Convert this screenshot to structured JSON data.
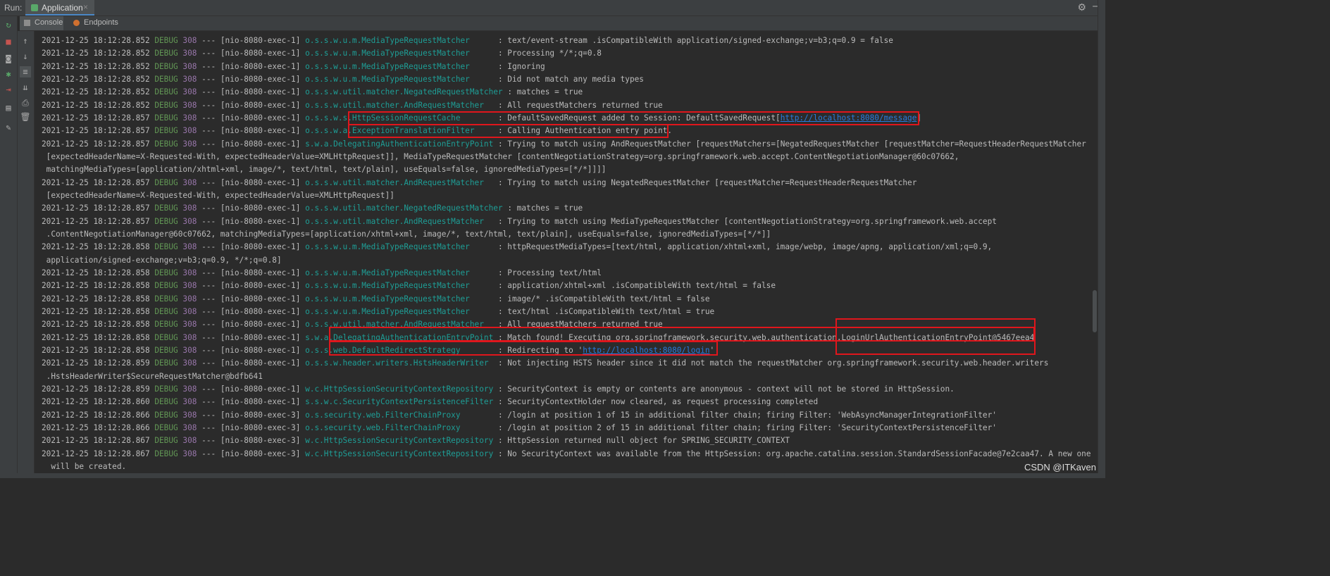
{
  "run": {
    "label": "Run:",
    "tab": "Application"
  },
  "console_tabs": [
    {
      "label": "Console"
    },
    {
      "label": "Endpoints"
    }
  ],
  "url_message": "http://localhost:8080/message",
  "url_login": "http://localhost:8080/login",
  "watermark": "CSDN @ITKaven",
  "log_lines": [
    {
      "ts": "2021-12-25 18:12:28.852",
      "level": "DEBUG",
      "pid": "308",
      "thread": "--- [nio-8080-exec-1]",
      "logger": "o.s.s.w.u.m.MediaTypeRequestMatcher",
      "msg": ": text/event-stream .isCompatibleWith application/signed-exchange;v=b3;q=0.9 = false"
    },
    {
      "ts": "2021-12-25 18:12:28.852",
      "level": "DEBUG",
      "pid": "308",
      "thread": "--- [nio-8080-exec-1]",
      "logger": "o.s.s.w.u.m.MediaTypeRequestMatcher",
      "msg": ": Processing */*;q=0.8"
    },
    {
      "ts": "2021-12-25 18:12:28.852",
      "level": "DEBUG",
      "pid": "308",
      "thread": "--- [nio-8080-exec-1]",
      "logger": "o.s.s.w.u.m.MediaTypeRequestMatcher",
      "msg": ": Ignoring"
    },
    {
      "ts": "2021-12-25 18:12:28.852",
      "level": "DEBUG",
      "pid": "308",
      "thread": "--- [nio-8080-exec-1]",
      "logger": "o.s.s.w.u.m.MediaTypeRequestMatcher",
      "msg": ": Did not match any media types"
    },
    {
      "ts": "2021-12-25 18:12:28.852",
      "level": "DEBUG",
      "pid": "308",
      "thread": "--- [nio-8080-exec-1]",
      "logger": "o.s.s.w.util.matcher.NegatedRequestMatcher",
      "msg": ": matches = true"
    },
    {
      "ts": "2021-12-25 18:12:28.852",
      "level": "DEBUG",
      "pid": "308",
      "thread": "--- [nio-8080-exec-1]",
      "logger": "o.s.s.w.util.matcher.AndRequestMatcher",
      "msg": ": All requestMatchers returned true"
    },
    {
      "ts": "2021-12-25 18:12:28.857",
      "level": "DEBUG",
      "pid": "308",
      "thread": "--- [nio-8080-exec-1]",
      "logger": "o.s.s.w.s.HttpSessionRequestCache",
      "msg": ": DefaultSavedRequest added to Session: DefaultSavedRequest["
    },
    {
      "ts": "2021-12-25 18:12:28.857",
      "level": "DEBUG",
      "pid": "308",
      "thread": "--- [nio-8080-exec-1]",
      "logger": "o.s.s.w.a.ExceptionTranslationFilter",
      "msg": ": Calling Authentication entry point."
    },
    {
      "ts": "2021-12-25 18:12:28.857",
      "level": "DEBUG",
      "pid": "308",
      "thread": "--- [nio-8080-exec-1]",
      "logger": "s.w.a.DelegatingAuthenticationEntryPoint",
      "msg": ": Trying to match using AndRequestMatcher [requestMatchers=[NegatedRequestMatcher [requestMatcher=RequestHeaderRequestMatcher"
    },
    {
      "cont": " [expectedHeaderName=X-Requested-With, expectedHeaderValue=XMLHttpRequest]], MediaTypeRequestMatcher [contentNegotiationStrategy=org.springframework.web.accept.ContentNegotiationManager@60c07662,"
    },
    {
      "cont": " matchingMediaTypes=[application/xhtml+xml, image/*, text/html, text/plain], useEquals=false, ignoredMediaTypes=[*/*]]]]"
    },
    {
      "ts": "2021-12-25 18:12:28.857",
      "level": "DEBUG",
      "pid": "308",
      "thread": "--- [nio-8080-exec-1]",
      "logger": "o.s.s.w.util.matcher.AndRequestMatcher",
      "msg": ": Trying to match using NegatedRequestMatcher [requestMatcher=RequestHeaderRequestMatcher"
    },
    {
      "cont": " [expectedHeaderName=X-Requested-With, expectedHeaderValue=XMLHttpRequest]]"
    },
    {
      "ts": "2021-12-25 18:12:28.857",
      "level": "DEBUG",
      "pid": "308",
      "thread": "--- [nio-8080-exec-1]",
      "logger": "o.s.s.w.util.matcher.NegatedRequestMatcher",
      "msg": ": matches = true"
    },
    {
      "ts": "2021-12-25 18:12:28.857",
      "level": "DEBUG",
      "pid": "308",
      "thread": "--- [nio-8080-exec-1]",
      "logger": "o.s.s.w.util.matcher.AndRequestMatcher",
      "msg": ": Trying to match using MediaTypeRequestMatcher [contentNegotiationStrategy=org.springframework.web.accept"
    },
    {
      "cont": " .ContentNegotiationManager@60c07662, matchingMediaTypes=[application/xhtml+xml, image/*, text/html, text/plain], useEquals=false, ignoredMediaTypes=[*/*]]"
    },
    {
      "ts": "2021-12-25 18:12:28.858",
      "level": "DEBUG",
      "pid": "308",
      "thread": "--- [nio-8080-exec-1]",
      "logger": "o.s.s.w.u.m.MediaTypeRequestMatcher",
      "msg": ": httpRequestMediaTypes=[text/html, application/xhtml+xml, image/webp, image/apng, application/xml;q=0.9,"
    },
    {
      "cont": " application/signed-exchange;v=b3;q=0.9, */*;q=0.8]"
    },
    {
      "ts": "2021-12-25 18:12:28.858",
      "level": "DEBUG",
      "pid": "308",
      "thread": "--- [nio-8080-exec-1]",
      "logger": "o.s.s.w.u.m.MediaTypeRequestMatcher",
      "msg": ": Processing text/html"
    },
    {
      "ts": "2021-12-25 18:12:28.858",
      "level": "DEBUG",
      "pid": "308",
      "thread": "--- [nio-8080-exec-1]",
      "logger": "o.s.s.w.u.m.MediaTypeRequestMatcher",
      "msg": ": application/xhtml+xml .isCompatibleWith text/html = false"
    },
    {
      "ts": "2021-12-25 18:12:28.858",
      "level": "DEBUG",
      "pid": "308",
      "thread": "--- [nio-8080-exec-1]",
      "logger": "o.s.s.w.u.m.MediaTypeRequestMatcher",
      "msg": ": image/* .isCompatibleWith text/html = false"
    },
    {
      "ts": "2021-12-25 18:12:28.858",
      "level": "DEBUG",
      "pid": "308",
      "thread": "--- [nio-8080-exec-1]",
      "logger": "o.s.s.w.u.m.MediaTypeRequestMatcher",
      "msg": ": text/html .isCompatibleWith text/html = true"
    },
    {
      "ts": "2021-12-25 18:12:28.858",
      "level": "DEBUG",
      "pid": "308",
      "thread": "--- [nio-8080-exec-1]",
      "logger": "o.s.s.w.util.matcher.AndRequestMatcher",
      "msg": ": All requestMatchers returned true"
    },
    {
      "ts": "2021-12-25 18:12:28.858",
      "level": "DEBUG",
      "pid": "308",
      "thread": "--- [nio-8080-exec-1]",
      "logger": "s.w.a.DelegatingAuthenticationEntryPoint",
      "msg": ": Match found! Executing org.springframework.security.web.authentication.LoginUrlAuthenticationEntryPoint@5467eea4"
    },
    {
      "ts": "2021-12-25 18:12:28.858",
      "level": "DEBUG",
      "pid": "308",
      "thread": "--- [nio-8080-exec-1]",
      "logger": "o.s.s.web.DefaultRedirectStrategy",
      "msg": ": Redirecting to '"
    },
    {
      "ts": "2021-12-25 18:12:28.859",
      "level": "DEBUG",
      "pid": "308",
      "thread": "--- [nio-8080-exec-1]",
      "logger": "o.s.s.w.header.writers.HstsHeaderWriter",
      "msg": ": Not injecting HSTS header since it did not match the requestMatcher org.springframework.security.web.header.writers"
    },
    {
      "cont": " .HstsHeaderWriter$SecureRequestMatcher@bdfb641"
    },
    {
      "ts": "2021-12-25 18:12:28.859",
      "level": "DEBUG",
      "pid": "308",
      "thread": "--- [nio-8080-exec-1]",
      "logger": "w.c.HttpSessionSecurityContextRepository",
      "msg": ": SecurityContext is empty or contents are anonymous - context will not be stored in HttpSession."
    },
    {
      "ts": "2021-12-25 18:12:28.860",
      "level": "DEBUG",
      "pid": "308",
      "thread": "--- [nio-8080-exec-1]",
      "logger": "s.s.w.c.SecurityContextPersistenceFilter",
      "msg": ": SecurityContextHolder now cleared, as request processing completed"
    },
    {
      "ts": "2021-12-25 18:12:28.866",
      "level": "DEBUG",
      "pid": "308",
      "thread": "--- [nio-8080-exec-3]",
      "logger": "o.s.security.web.FilterChainProxy",
      "msg": ": /login at position 1 of 15 in additional filter chain; firing Filter: 'WebAsyncManagerIntegrationFilter'"
    },
    {
      "ts": "2021-12-25 18:12:28.866",
      "level": "DEBUG",
      "pid": "308",
      "thread": "--- [nio-8080-exec-3]",
      "logger": "o.s.security.web.FilterChainProxy",
      "msg": ": /login at position 2 of 15 in additional filter chain; firing Filter: 'SecurityContextPersistenceFilter'"
    },
    {
      "ts": "2021-12-25 18:12:28.867",
      "level": "DEBUG",
      "pid": "308",
      "thread": "--- [nio-8080-exec-3]",
      "logger": "w.c.HttpSessionSecurityContextRepository",
      "msg": ": HttpSession returned null object for SPRING_SECURITY_CONTEXT"
    },
    {
      "ts": "2021-12-25 18:12:28.867",
      "level": "DEBUG",
      "pid": "308",
      "thread": "--- [nio-8080-exec-3]",
      "logger": "w.c.HttpSessionSecurityContextRepository",
      "msg": ": No SecurityContext was available from the HttpSession: org.apache.catalina.session.StandardSessionFacade@7e2caa47. A new one"
    },
    {
      "cont": "  will be created."
    }
  ]
}
